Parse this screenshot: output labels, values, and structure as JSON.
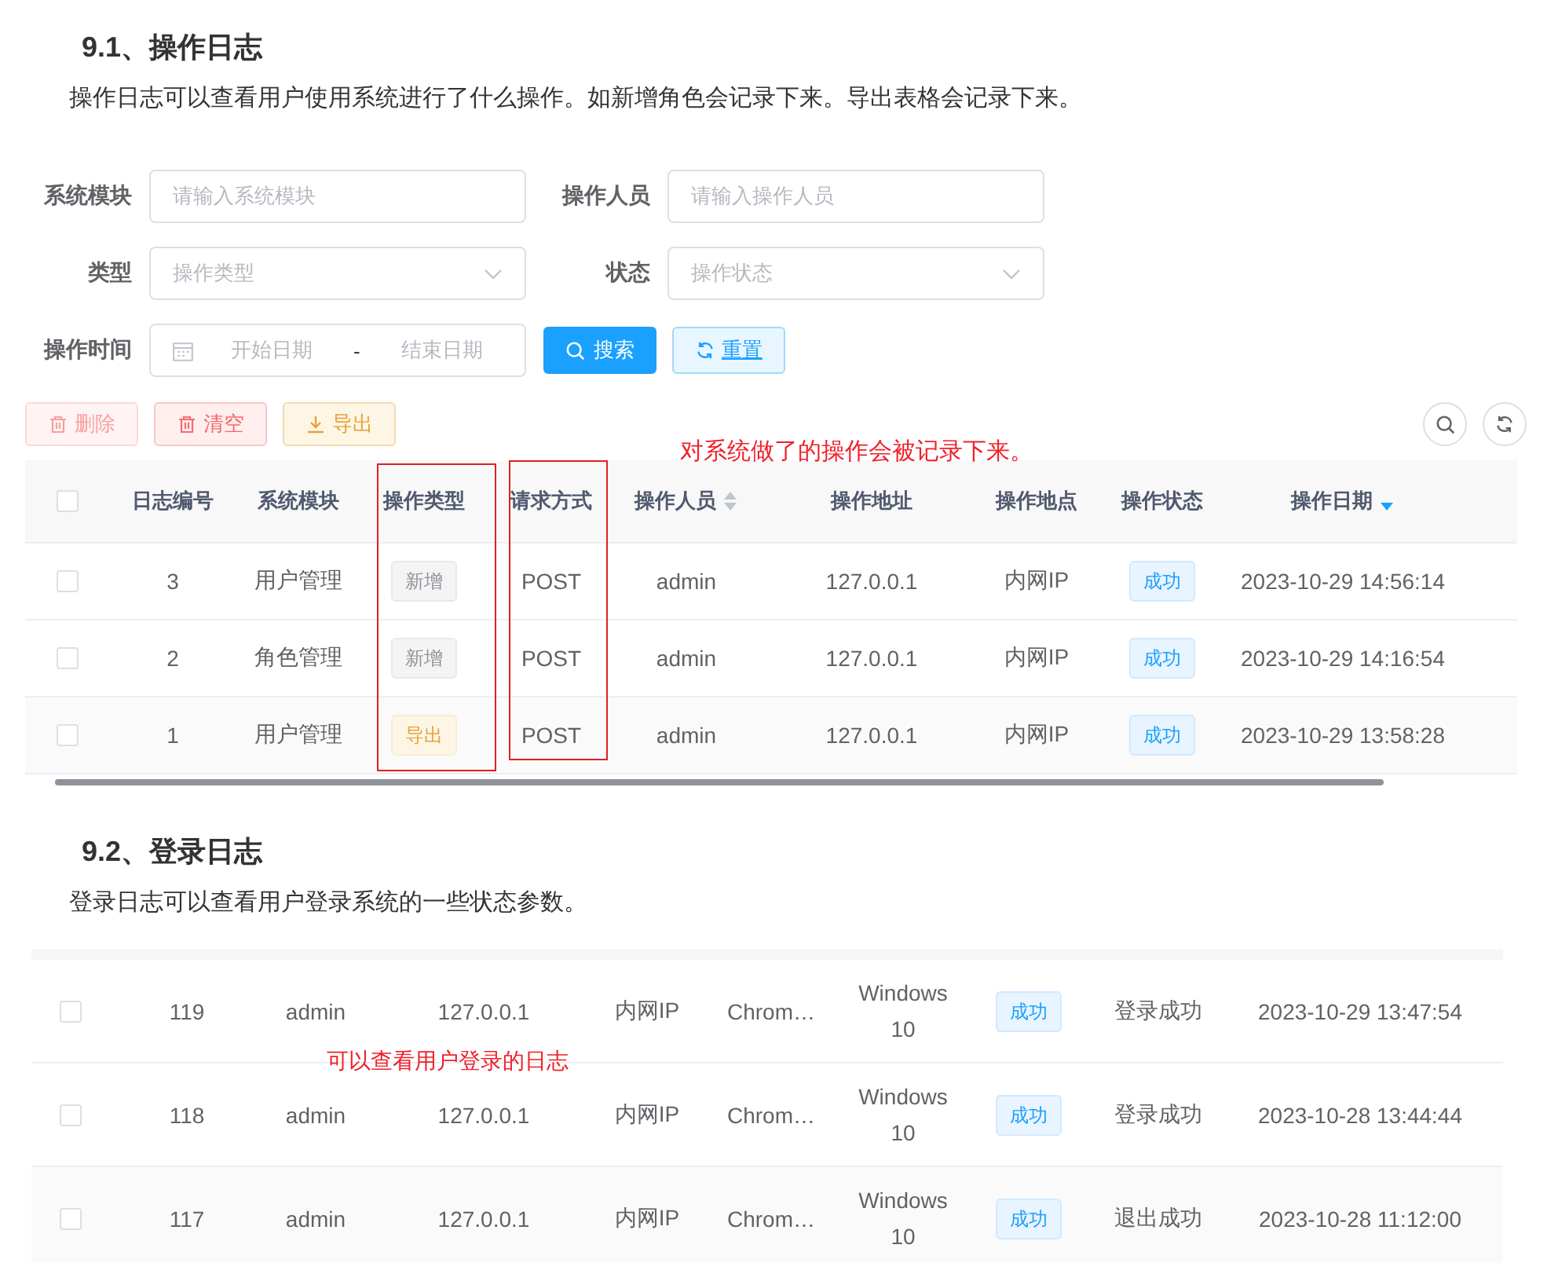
{
  "section_1": {
    "heading": "9.1、操作日志",
    "intro": "操作日志可以查看用户使用系统进行了什么操作。如新增角色会记录下来。导出表格会记录下来。"
  },
  "filters": [
    {
      "kind": "text",
      "label": "系统模块",
      "placeholder": "请输入系统模块"
    },
    {
      "kind": "text",
      "label": "操作人员",
      "placeholder": "请输入操作人员"
    },
    {
      "kind": "select",
      "label": "类型",
      "placeholder": "操作类型"
    },
    {
      "kind": "select",
      "label": "状态",
      "placeholder": "操作状态"
    },
    {
      "kind": "daterange",
      "label": "操作时间",
      "start_placeholder": "开始日期",
      "separator": "-",
      "end_placeholder": "结束日期"
    }
  ],
  "filter_buttons": [
    {
      "kind": "search",
      "label": "搜索"
    },
    {
      "kind": "reset",
      "label": "重置"
    }
  ],
  "toolbar": [
    {
      "kind": "delete",
      "label": "删除",
      "disabled": true
    },
    {
      "kind": "clear",
      "label": "清空",
      "disabled": false
    },
    {
      "kind": "export",
      "label": "导出",
      "disabled": false
    }
  ],
  "annotation_1": "对系统做了的操作会被记录下来。",
  "oper_table": {
    "select_all_checked": false,
    "columns": [
      {
        "label": "日志编号"
      },
      {
        "label": "系统模块"
      },
      {
        "label": "操作类型"
      },
      {
        "label": "请求方式"
      },
      {
        "label": "操作人员",
        "sortable": true,
        "sorted_desc": false
      },
      {
        "label": "操作地址"
      },
      {
        "label": "操作地点"
      },
      {
        "label": "操作状态"
      },
      {
        "label": "操作日期",
        "sortable": true,
        "sorted_desc": true
      }
    ],
    "rows": [
      {
        "checked": false,
        "id": "3",
        "module": "用户管理",
        "type": {
          "kind": "add",
          "label": "新增"
        },
        "method": "POST",
        "operator": "admin",
        "address": "127.0.0.1",
        "location": "内网IP",
        "status": {
          "kind": "success",
          "label": "成功"
        },
        "date": "2023-10-29 14:56:14"
      },
      {
        "checked": false,
        "id": "2",
        "module": "角色管理",
        "type": {
          "kind": "add",
          "label": "新增"
        },
        "method": "POST",
        "operator": "admin",
        "address": "127.0.0.1",
        "location": "内网IP",
        "status": {
          "kind": "success",
          "label": "成功"
        },
        "date": "2023-10-29 14:16:54"
      },
      {
        "checked": false,
        "id": "1",
        "module": "用户管理",
        "type": {
          "kind": "export",
          "label": "导出"
        },
        "method": "POST",
        "operator": "admin",
        "address": "127.0.0.1",
        "location": "内网IP",
        "status": {
          "kind": "success",
          "label": "成功"
        },
        "date": "2023-10-29 13:58:28"
      }
    ]
  },
  "section_2": {
    "heading": "9.2、登录日志",
    "intro": "登录日志可以查看用户登录系统的一些状态参数。"
  },
  "annotation_2": "可以查看用户登录的日志",
  "login_table": {
    "rows": [
      {
        "checked": false,
        "id": "119",
        "user": "admin",
        "address": "127.0.0.1",
        "location": "内网IP",
        "browser": "Chrom…",
        "os": "Windows 10",
        "status": {
          "kind": "success",
          "label": "成功"
        },
        "message": "登录成功",
        "date": "2023-10-29 13:47:54"
      },
      {
        "checked": false,
        "id": "118",
        "user": "admin",
        "address": "127.0.0.1",
        "location": "内网IP",
        "browser": "Chrom…",
        "os": "Windows 10",
        "status": {
          "kind": "success",
          "label": "成功"
        },
        "message": "登录成功",
        "date": "2023-10-28 13:44:44"
      },
      {
        "checked": false,
        "id": "117",
        "user": "admin",
        "address": "127.0.0.1",
        "location": "内网IP",
        "browser": "Chrom…",
        "os": "Windows 10",
        "status": {
          "kind": "success",
          "label": "成功"
        },
        "message": "退出成功",
        "date": "2023-10-28 11:12:00"
      }
    ]
  }
}
